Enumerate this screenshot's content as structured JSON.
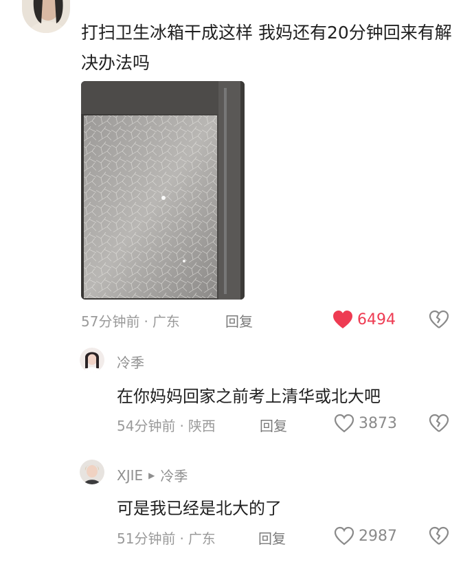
{
  "main_comment": {
    "text": "打扫卫生冰箱干成这样 我妈还有20分钟回来有解决办法吗",
    "time": "57分钟前",
    "location": "广东",
    "reply_label": "回复",
    "likes": "6494",
    "liked": true
  },
  "replies": [
    {
      "username": "冷季",
      "text": "在你妈妈回家之前考上清华或北大吧",
      "time": "54分钟前",
      "location": "陕西",
      "reply_label": "回复",
      "likes": "3873"
    },
    {
      "username": "XJIE",
      "reply_to": "冷季",
      "text": "可是我已经是北大的了",
      "time": "51分钟前",
      "location": "广东",
      "reply_label": "回复",
      "likes": "2987"
    }
  ],
  "icons": {
    "like": "heart-icon",
    "dislike": "broken-heart-icon",
    "reply_arrow": "triangle-right-icon"
  },
  "colors": {
    "liked": "#ee3b52",
    "meta": "#9a9a9a"
  }
}
